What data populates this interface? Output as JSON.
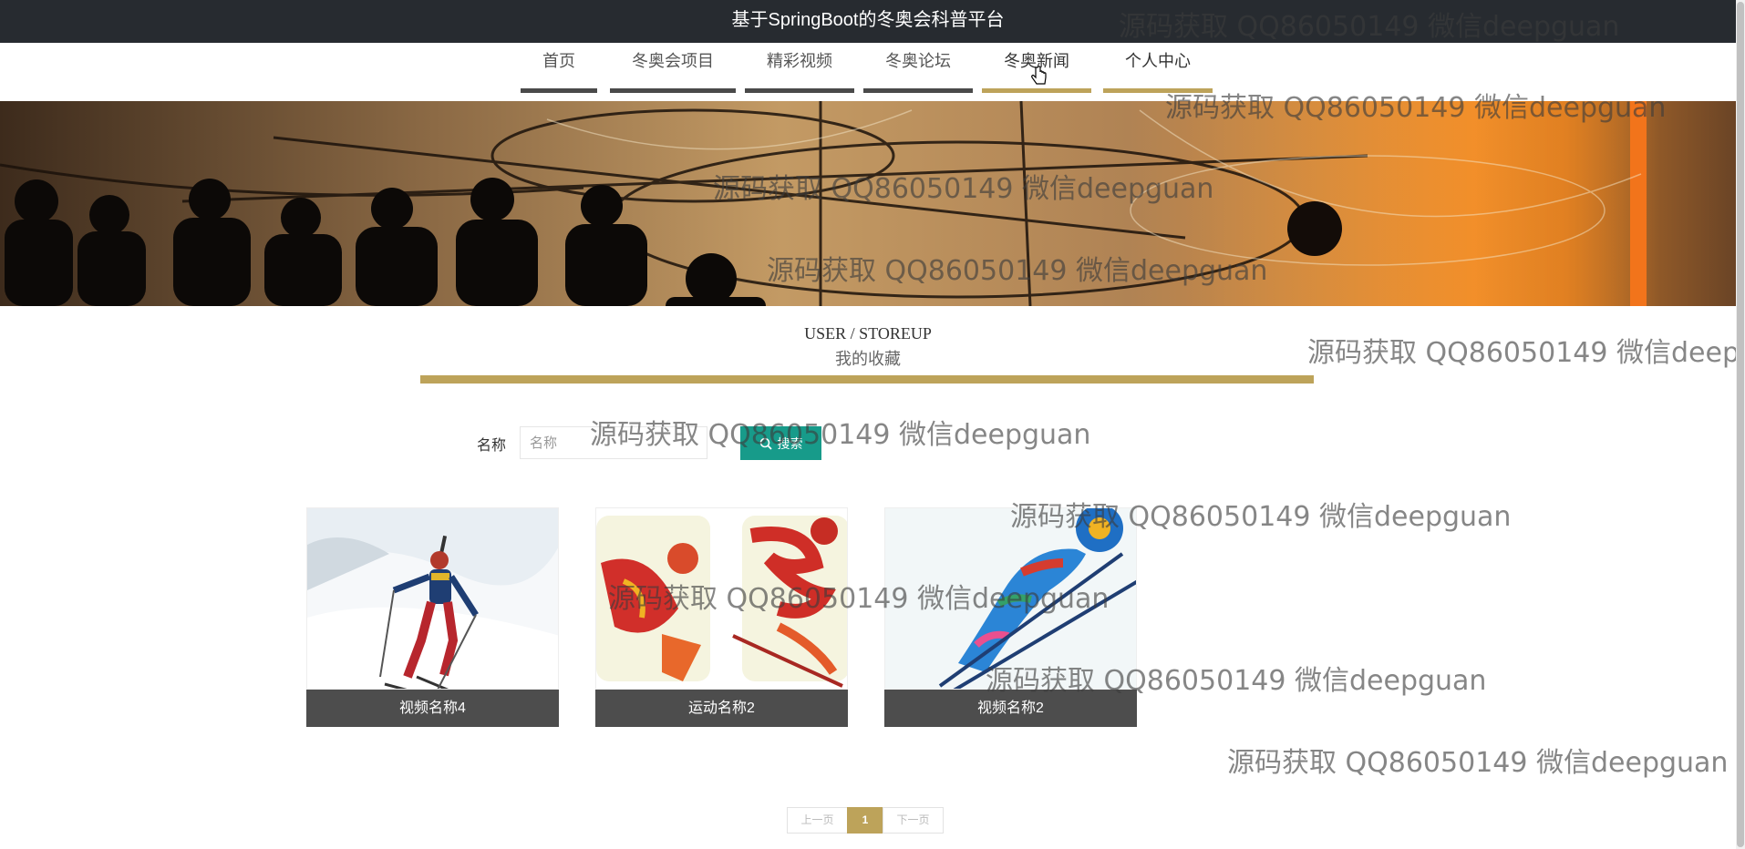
{
  "header": {
    "title": "基于SpringBoot的冬奥会科普平台"
  },
  "nav": {
    "items": [
      {
        "label": "首页",
        "active": false
      },
      {
        "label": "冬奥会项目",
        "active": false
      },
      {
        "label": "精彩视频",
        "active": false
      },
      {
        "label": "冬奥论坛",
        "active": false
      },
      {
        "label": "冬奥新闻",
        "active": true
      },
      {
        "label": "个人中心",
        "active": true
      }
    ]
  },
  "section": {
    "title_en": "USER / STOREUP",
    "title_cn": "我的收藏"
  },
  "search": {
    "label": "名称",
    "placeholder": "名称",
    "value": "",
    "button_label": "搜索"
  },
  "cards": [
    {
      "caption": "视频名称4",
      "image": "biathlon-skier-photo"
    },
    {
      "caption": "运动名称2",
      "image": "olympic-pictogram-poster"
    },
    {
      "caption": "视频名称2",
      "image": "ski-jump-pictogram"
    }
  ],
  "pagination": {
    "prev_label": "上一页",
    "current_page": "1",
    "next_label": "下一页"
  },
  "watermark": {
    "text": "源码获取 QQ86050149 微信deepguan",
    "text_truncated": "源码获取 QQ86050149 微信deepg"
  },
  "colors": {
    "titlebar_bg": "#272b30",
    "accent_gold": "#bda35a",
    "nav_bar_dark": "#4a4a4a",
    "search_button": "#179b8a",
    "caption_bg": "#4d4d4d"
  }
}
